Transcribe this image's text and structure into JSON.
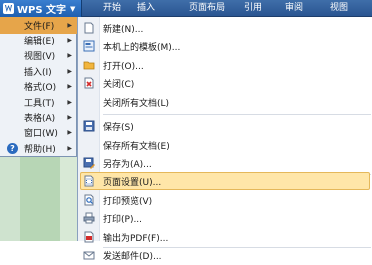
{
  "app": {
    "title": "WPS 文字"
  },
  "tabs": [
    "开始",
    "插入",
    "页面布局",
    "引用",
    "审阅",
    "视图"
  ],
  "left_menu": [
    {
      "label": "文件(F)",
      "active": true
    },
    {
      "label": "编辑(E)",
      "active": false
    },
    {
      "label": "视图(V)",
      "active": false
    },
    {
      "label": "插入(I)",
      "active": false
    },
    {
      "label": "格式(O)",
      "active": false
    },
    {
      "label": "工具(T)",
      "active": false
    },
    {
      "label": "表格(A)",
      "active": false
    },
    {
      "label": "窗口(W)",
      "active": false
    },
    {
      "label": "帮助(H)",
      "active": false
    }
  ],
  "file_menu": [
    {
      "label": "新建(N)...",
      "icon": "new-document-icon"
    },
    {
      "label": "本机上的模板(M)...",
      "icon": "template-icon"
    },
    {
      "label": "打开(O)...",
      "icon": "open-folder-icon"
    },
    {
      "label": "关闭(C)",
      "icon": "close-document-icon"
    },
    {
      "label": "关闭所有文档(L)",
      "icon": ""
    },
    {
      "label": "保存(S)",
      "icon": "save-icon"
    },
    {
      "label": "保存所有文档(E)",
      "icon": ""
    },
    {
      "label": "另存为(A)...",
      "icon": "save-as-icon"
    },
    {
      "label": "页面设置(U)...",
      "icon": "page-setup-icon",
      "highlighted": true
    },
    {
      "label": "打印预览(V)",
      "icon": "print-preview-icon"
    },
    {
      "label": "打印(P)...",
      "icon": "print-icon"
    },
    {
      "label": "输出为PDF(F)...",
      "icon": "pdf-export-icon"
    },
    {
      "label": "发送邮件(D)...",
      "icon": "email-icon"
    }
  ],
  "colors": {
    "topbar": "#2a5591",
    "highlight": "#ffe6a8",
    "active_menu": "#e6a54a"
  }
}
